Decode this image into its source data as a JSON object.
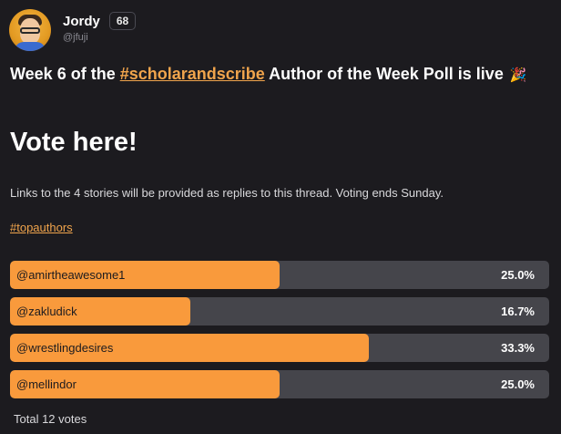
{
  "author": {
    "display_name": "Jordy",
    "handle": "@jfuji",
    "badge": "68"
  },
  "post": {
    "title_prefix": "Week 6 of the ",
    "title_hashtag": "#scholarandscribe",
    "title_suffix": " Author of the Week Poll is live",
    "heading": "Vote here!",
    "body": "Links to the 4 stories will be provided as replies to this thread. Voting ends Sunday.",
    "tag": "#topauthors"
  },
  "poll": {
    "options": [
      {
        "label": "@amirtheawesome1",
        "percent_text": "25.0%",
        "fraction": 0.25
      },
      {
        "label": "@zakludick",
        "percent_text": "16.7%",
        "fraction": 0.167
      },
      {
        "label": "@wrestlingdesires",
        "percent_text": "33.3%",
        "fraction": 0.333
      },
      {
        "label": "@mellindor",
        "percent_text": "25.0%",
        "fraction": 0.25
      }
    ],
    "total": "Total 12 votes"
  },
  "colors": {
    "accent": "#f99a3c",
    "link": "#f0a44c",
    "bar_track": "#45454b",
    "background": "#1c1b1f"
  }
}
